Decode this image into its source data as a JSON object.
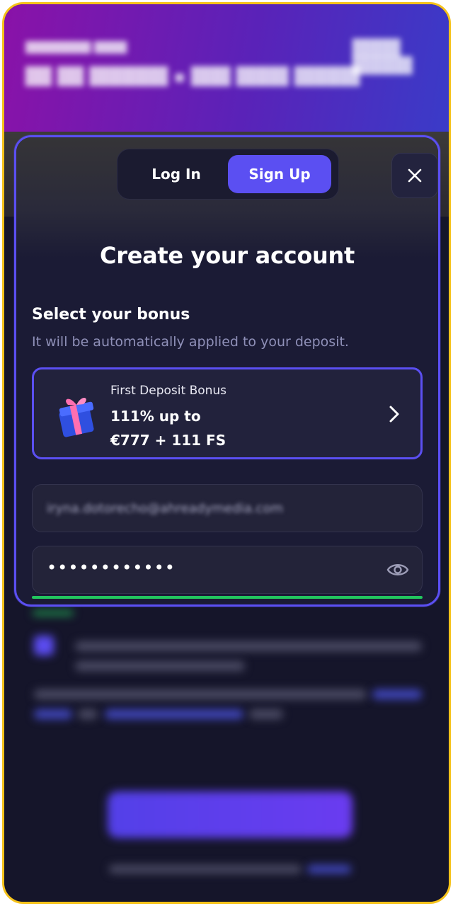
{
  "tabs": {
    "login": "Log In",
    "signup": "Sign Up",
    "active": "signup"
  },
  "title": "Create your account",
  "bonus_section": {
    "heading": "Select your bonus",
    "subheading": "It will be automatically applied to your deposit.",
    "card": {
      "name": "First Deposit Bonus",
      "line1": "111% up to",
      "line2": "€777 + 111 FS",
      "icon": "gift-icon"
    }
  },
  "form": {
    "email_value": "iryna.dotorecho@ahreadymedia.com",
    "password_masked": "••••••••••••"
  },
  "colors": {
    "accent": "#5b4ff2",
    "frame": "#f5c21a",
    "strength": "#22c55e",
    "background": "#15152a"
  }
}
